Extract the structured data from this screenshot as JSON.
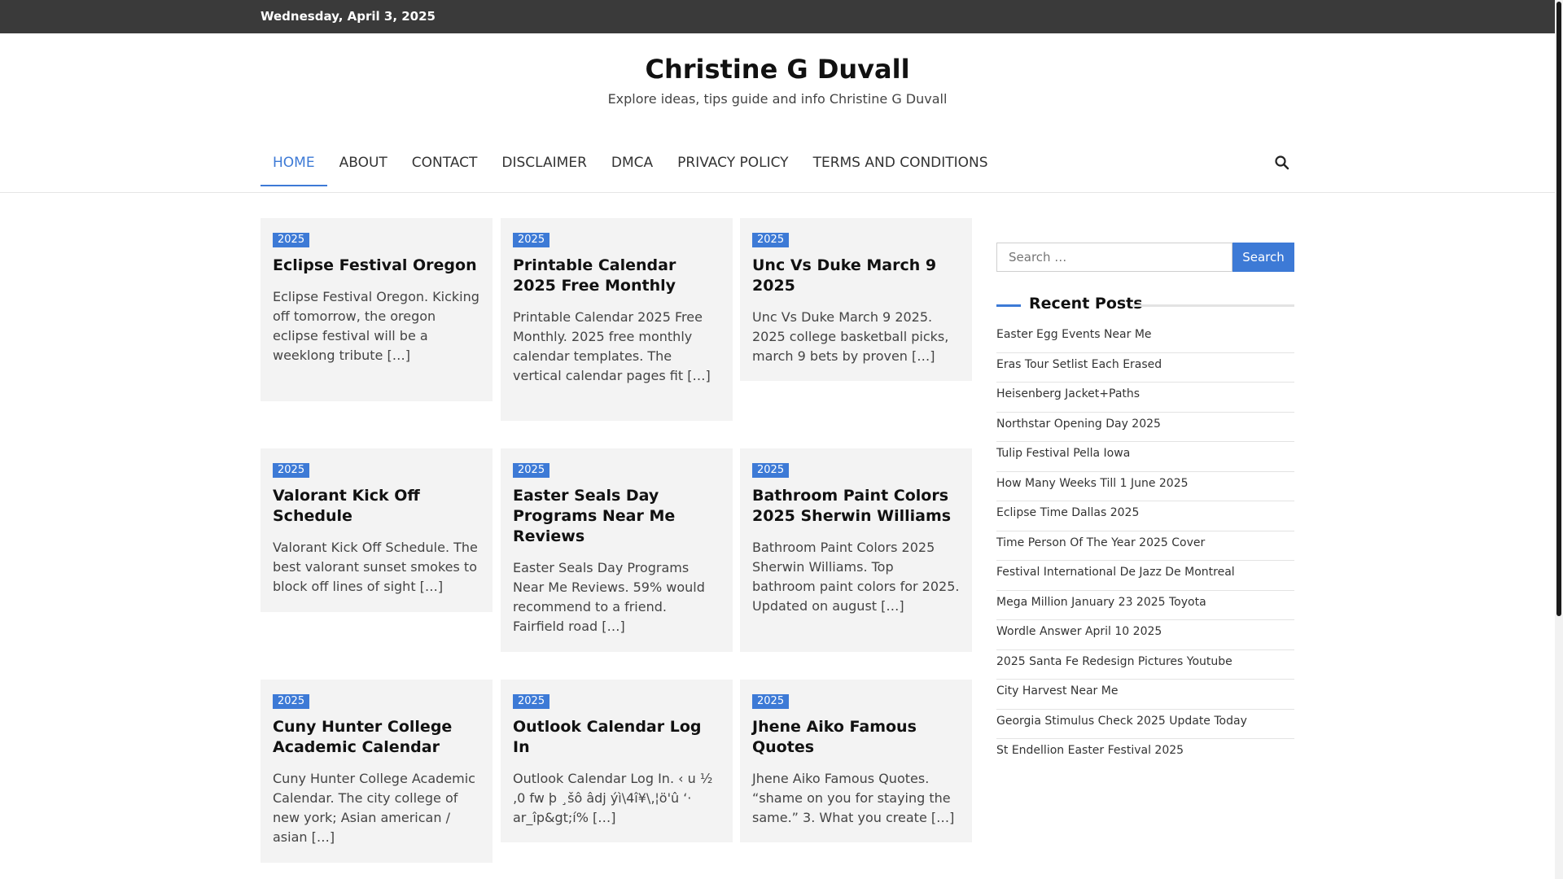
{
  "topbar": {
    "date": "Wednesday, April 3, 2025"
  },
  "header": {
    "title": "Christine G Duvall",
    "tagline": "Explore ideas, tips guide and info Christine G Duvall"
  },
  "nav": {
    "items": [
      "HOME",
      "ABOUT",
      "CONTACT",
      "DISCLAIMER",
      "DMCA",
      "PRIVACY POLICY",
      "TERMS AND CONDITIONS"
    ],
    "active": "HOME",
    "search_icon": "search-icon"
  },
  "posts": [
    {
      "badge": "2025",
      "title": "Eclipse Festival Oregon",
      "excerpt": "Eclipse Festival Oregon. Kicking off tomorrow, the oregon eclipse festival will be a weeklong tribute […]"
    },
    {
      "badge": "2025",
      "title": "Printable Calendar 2025 Free Monthly",
      "excerpt": "Printable Calendar 2025 Free Monthly. 2025 free monthly calendar templates. The vertical calendar pages fit […]"
    },
    {
      "badge": "2025",
      "title": "Unc Vs Duke March 9 2025",
      "excerpt": "Unc Vs Duke March 9 2025. 2025 college basketball picks, march 9 bets by proven […]"
    },
    {
      "badge": "2025",
      "title": "Valorant Kick Off Schedule",
      "excerpt": "Valorant Kick Off Schedule. The best valorant sunset smokes to block off lines of sight […]"
    },
    {
      "badge": "2025",
      "title": "Easter Seals Day Programs Near Me Reviews",
      "excerpt": "Easter Seals Day Programs Near Me Reviews. 59% would recommend to a friend. Fairfield road […]"
    },
    {
      "badge": "2025",
      "title": "Bathroom Paint Colors 2025 Sherwin Williams",
      "excerpt": "Bathroom Paint Colors 2025 Sherwin Williams. Top bathroom paint colors for 2025. Updated on august […]"
    },
    {
      "badge": "2025",
      "title": "Cuny Hunter College Academic Calendar",
      "excerpt": "Cuny Hunter College Academic Calendar. The city college of new york; Asian american / asian […]"
    },
    {
      "badge": "2025",
      "title": "Outlook Calendar Log In",
      "excerpt": "Outlook Calendar Log In. ‹ u ½ ‚0 fw þ ¸šô âdj ýì\\4î¥\\‚¦ö'û ‘· ar_îp&gt;í% […]"
    },
    {
      "badge": "2025",
      "title": "Jhene Aiko Famous Quotes",
      "excerpt": "Jhene Aiko Famous Quotes. “shame on you for staying the same.” 3. What you create […]"
    }
  ],
  "sidebar": {
    "search": {
      "placeholder": "Search …",
      "button": "Search"
    },
    "recent_title": "Recent Posts",
    "recent_posts": [
      "Easter Egg Events Near Me",
      "Eras Tour Setlist Each Erased",
      "Heisenberg Jacket+Paths",
      "Northstar Opening Day 2025",
      "Tulip Festival Pella Iowa",
      "How Many Weeks Till 1 June 2025",
      "Eclipse Time Dallas 2025",
      "Time Person Of The Year 2025 Cover",
      "Festival International De Jazz De Montreal",
      "Mega Million January 23 2025 Toyota",
      "Wordle Answer April 10 2025",
      "2025 Santa Fe Redesign Pictures Youtube",
      "City Harvest Near Me",
      "Georgia Stimulus Check 2025 Update Today",
      "St Endellion Easter Festival 2025"
    ]
  },
  "colors": {
    "accent": "#3d7ad6",
    "topbar": "#3a3a3a",
    "card_bg": "#f3f3f3"
  }
}
